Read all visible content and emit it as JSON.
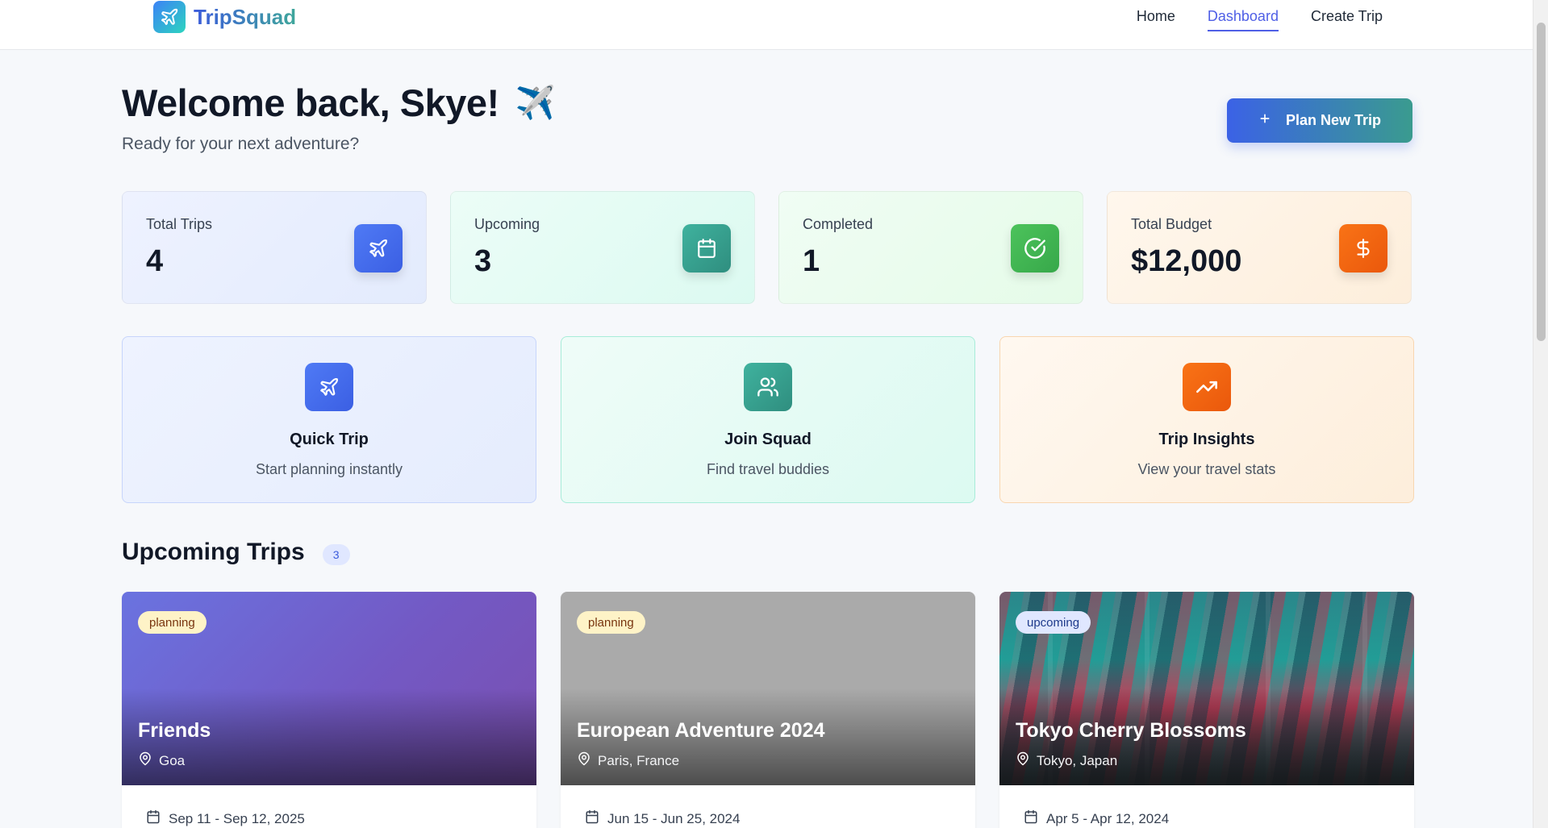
{
  "header": {
    "brand": "TripSquad",
    "nav": [
      {
        "label": "Home"
      },
      {
        "label": "Dashboard"
      },
      {
        "label": "Create Trip"
      }
    ]
  },
  "welcome": {
    "title": "Welcome back, Skye!",
    "emoji": "✈️",
    "subtitle": "Ready for your next adventure?",
    "plan_button": "Plan New Trip"
  },
  "stats": [
    {
      "label": "Total Trips",
      "value": "4",
      "icon": "plane-icon",
      "color": "#4f7af5"
    },
    {
      "label": "Upcoming",
      "value": "3",
      "icon": "calendar-icon",
      "color": "#3fb29e"
    },
    {
      "label": "Completed",
      "value": "1",
      "icon": "check-circle-icon",
      "color": "#4cc35b"
    },
    {
      "label": "Total Budget",
      "value": "$12,000",
      "icon": "dollar-icon",
      "color": "#f97316"
    }
  ],
  "actions": [
    {
      "title": "Quick Trip",
      "desc": "Start planning instantly",
      "icon": "plane-icon"
    },
    {
      "title": "Join Squad",
      "desc": "Find travel buddies",
      "icon": "users-icon"
    },
    {
      "title": "Trip Insights",
      "desc": "View your travel stats",
      "icon": "trending-up-icon"
    }
  ],
  "upcoming": {
    "title": "Upcoming Trips",
    "count": "3",
    "trips": [
      {
        "status": "planning",
        "name": "Friends",
        "location": "Goa",
        "dates": "Sep 11 - Sep 12, 2025"
      },
      {
        "status": "planning",
        "name": "European Adventure 2024",
        "location": "Paris, France",
        "dates": "Jun 15 - Jun 25, 2024"
      },
      {
        "status": "upcoming",
        "name": "Tokyo Cherry Blossoms",
        "location": "Tokyo, Japan",
        "dates": "Apr 5 - Apr 12, 2024"
      }
    ]
  }
}
